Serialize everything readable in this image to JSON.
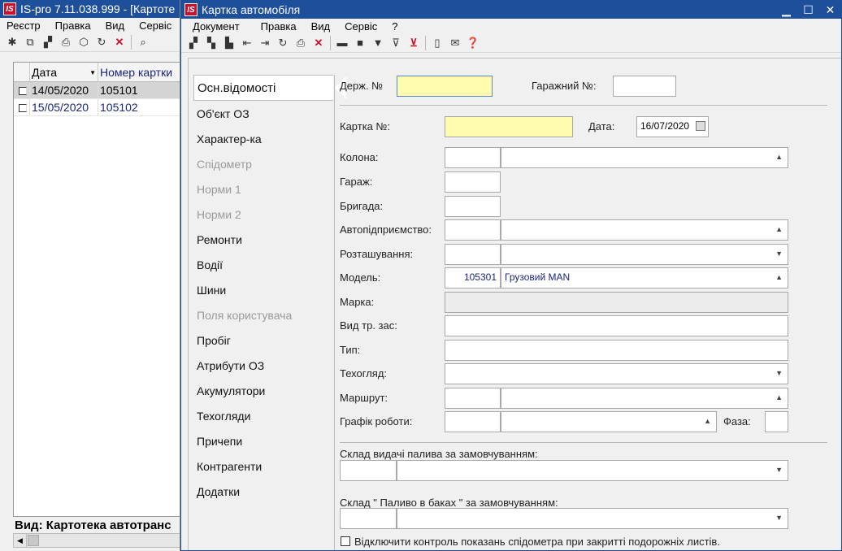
{
  "left_window": {
    "title": "IS-pro 7.11.038.999 - [Картоте",
    "logo": "IS",
    "menu": [
      "Реєстр",
      "Правка",
      "Вид",
      "Сервіс"
    ],
    "columns": [
      "Дата",
      "Номер картки"
    ],
    "rows": [
      {
        "date": "14/05/2020",
        "number": "105101"
      },
      {
        "date": "15/05/2020",
        "number": "105102"
      }
    ],
    "status": "Вид: Картотека автотранс"
  },
  "main_window": {
    "title": "Картка автомобіля",
    "logo": "IS",
    "menu": [
      "Документ",
      "Правка",
      "Вид",
      "Сервіс",
      "?"
    ],
    "nav": [
      {
        "label": "Осн.відомості",
        "state": "active"
      },
      {
        "label": "Об'єкт ОЗ",
        "state": "normal"
      },
      {
        "label": "Характер-ка",
        "state": "normal"
      },
      {
        "label": "Спідометр",
        "state": "disabled"
      },
      {
        "label": "Норми 1",
        "state": "disabled"
      },
      {
        "label": "Норми 2",
        "state": "disabled"
      },
      {
        "label": "Ремонти",
        "state": "normal"
      },
      {
        "label": "Водії",
        "state": "normal"
      },
      {
        "label": "Шини",
        "state": "normal"
      },
      {
        "label": "Поля користувача",
        "state": "disabled"
      },
      {
        "label": "Пробіг",
        "state": "normal"
      },
      {
        "label": "Атрибути ОЗ",
        "state": "normal"
      },
      {
        "label": "Акумулятори",
        "state": "normal"
      },
      {
        "label": "Техогляди",
        "state": "normal"
      },
      {
        "label": "Причепи",
        "state": "normal"
      },
      {
        "label": "Контрагенти",
        "state": "normal"
      },
      {
        "label": "Додатки",
        "state": "normal"
      }
    ],
    "form": {
      "derzh_label": "Держ. №",
      "derzh_value": "",
      "garage_no_label": "Гаражний №:",
      "garage_no_value": "",
      "card_label": "Картка №:",
      "card_value": "",
      "date_label": "Дата:",
      "date_value": "16/07/2020",
      "kolona_label": "Колона:",
      "garazh_label": "Гараж:",
      "bryhada_label": "Бригада:",
      "avtopid_label": "Автопідприємство:",
      "roztash_label": "Розташування:",
      "model_label": "Модель:",
      "model_code": "105301",
      "model_name": "Грузовий MAN",
      "marka_label": "Марка:",
      "vyd_label": "Вид тр. зас:",
      "typ_label": "Тип:",
      "tekhohliad_label": "Техогляд:",
      "marshrut_label": "Маршрут:",
      "grafik_label": "Графік роботи:",
      "faza_label": "Фаза:",
      "sklad1_label": "Склад видачі палива за замовчуванням:",
      "sklad2_label": "Склад \" Паливо в баках \" за замовчуванням:",
      "checkbox_label": "Відключити контроль показань спідометра при закритті подорожніх листів."
    }
  }
}
